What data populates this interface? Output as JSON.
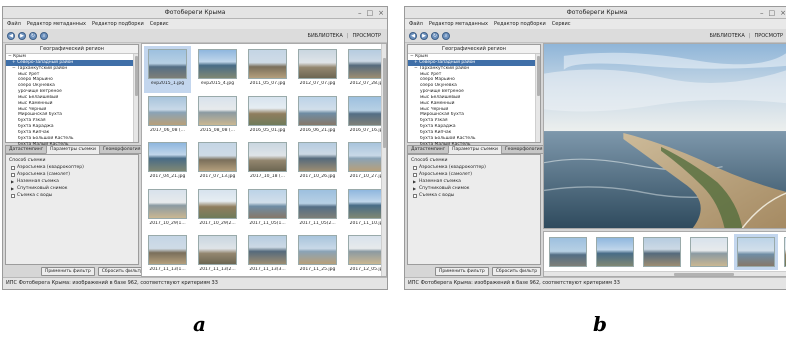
{
  "app": {
    "title": "Фотобереги Крыма",
    "window_buttons": [
      "–",
      "□",
      "×"
    ]
  },
  "menu": [
    "Файл",
    "Редактор метаданных",
    "Редактор подборки",
    "Сервис"
  ],
  "toolbar": {
    "icons": [
      "back-icon",
      "forward-icon",
      "refresh-icon",
      "search-icon"
    ],
    "library_label": "БИБЛИОТЕКА",
    "separator": "|",
    "preview_label": "ПРОСМОТР"
  },
  "tree": {
    "header": "Географический регион",
    "items": [
      {
        "label": "− Крым",
        "indent": 0
      },
      {
        "label": "+ Северо-западный район",
        "indent": 1,
        "selected": true
      },
      {
        "label": "− Тарханкутский район",
        "indent": 1
      },
      {
        "label": "мыс Урет",
        "indent": 2
      },
      {
        "label": "озеро Марьино",
        "indent": 2
      },
      {
        "label": "озеро Окуневка",
        "indent": 2
      },
      {
        "label": "урочище Ветреное",
        "indent": 2
      },
      {
        "label": "мыс Белаишевый",
        "indent": 2
      },
      {
        "label": "мыс Каменный",
        "indent": 2
      },
      {
        "label": "мыс Черный",
        "indent": 2
      },
      {
        "label": "Мирошнская бухта",
        "indent": 2
      },
      {
        "label": "бухта Узкая",
        "indent": 2
      },
      {
        "label": "бухта Караджа",
        "indent": 2
      },
      {
        "label": "бухта Кипчак",
        "indent": 2
      },
      {
        "label": "бухта Большой Кастель",
        "indent": 2
      },
      {
        "label": "бухта Малый Кастель",
        "indent": 2
      }
    ]
  },
  "tabs": [
    {
      "label": "Датастемпинг",
      "active": false
    },
    {
      "label": "Параметры съемки",
      "active": true
    },
    {
      "label": "Геоморфология",
      "active": false
    }
  ],
  "filter": {
    "title": "Способ съемки",
    "options": [
      {
        "label": "Аэросъемка (квадрокоптер)",
        "kind": "checkbox"
      },
      {
        "label": "Аэросъемка (самолет)",
        "kind": "checkbox"
      },
      {
        "label": "Наземная съемка",
        "kind": "expander"
      },
      {
        "label": "Спутниковый снимок",
        "kind": "expander"
      },
      {
        "label": "Съемка с воды",
        "kind": "checkbox"
      }
    ]
  },
  "buttons": {
    "apply": "Применить фильтр",
    "reset": "Сбросить фильтр"
  },
  "status": "ИПС Фотоберега Крыма: изображений в базе 962, соответствуют критериям 33",
  "thumbnails": [
    "evp2015_1.jpg",
    "evp2015_4.jpg",
    "2011_05_07.jpg",
    "2012_07_07.jpg",
    "2012_07_28.jpg",
    "2017_06_08 (...",
    "2015_08_08 (...",
    "2016_05_01.jpg",
    "2016_06_21.jpg",
    "2016_07_16.jpg",
    "2017_04_21.jpg",
    "2017_07_13.jpg",
    "2017_10_18 (...",
    "2017_10_26.jpg",
    "2017_10_27.jpg",
    "2017_10_29(1...",
    "2017_10_29(2...",
    "2017_11_05(1...",
    "2017_11_05(2...",
    "2017_11_10.jpg",
    "2017_11_13(1...",
    "2017_11_13(2...",
    "2017_11_13(3...",
    "2017_11_25.jpg",
    "2017_12_05.jpg"
  ],
  "captions": {
    "a": "a",
    "b": "b"
  }
}
